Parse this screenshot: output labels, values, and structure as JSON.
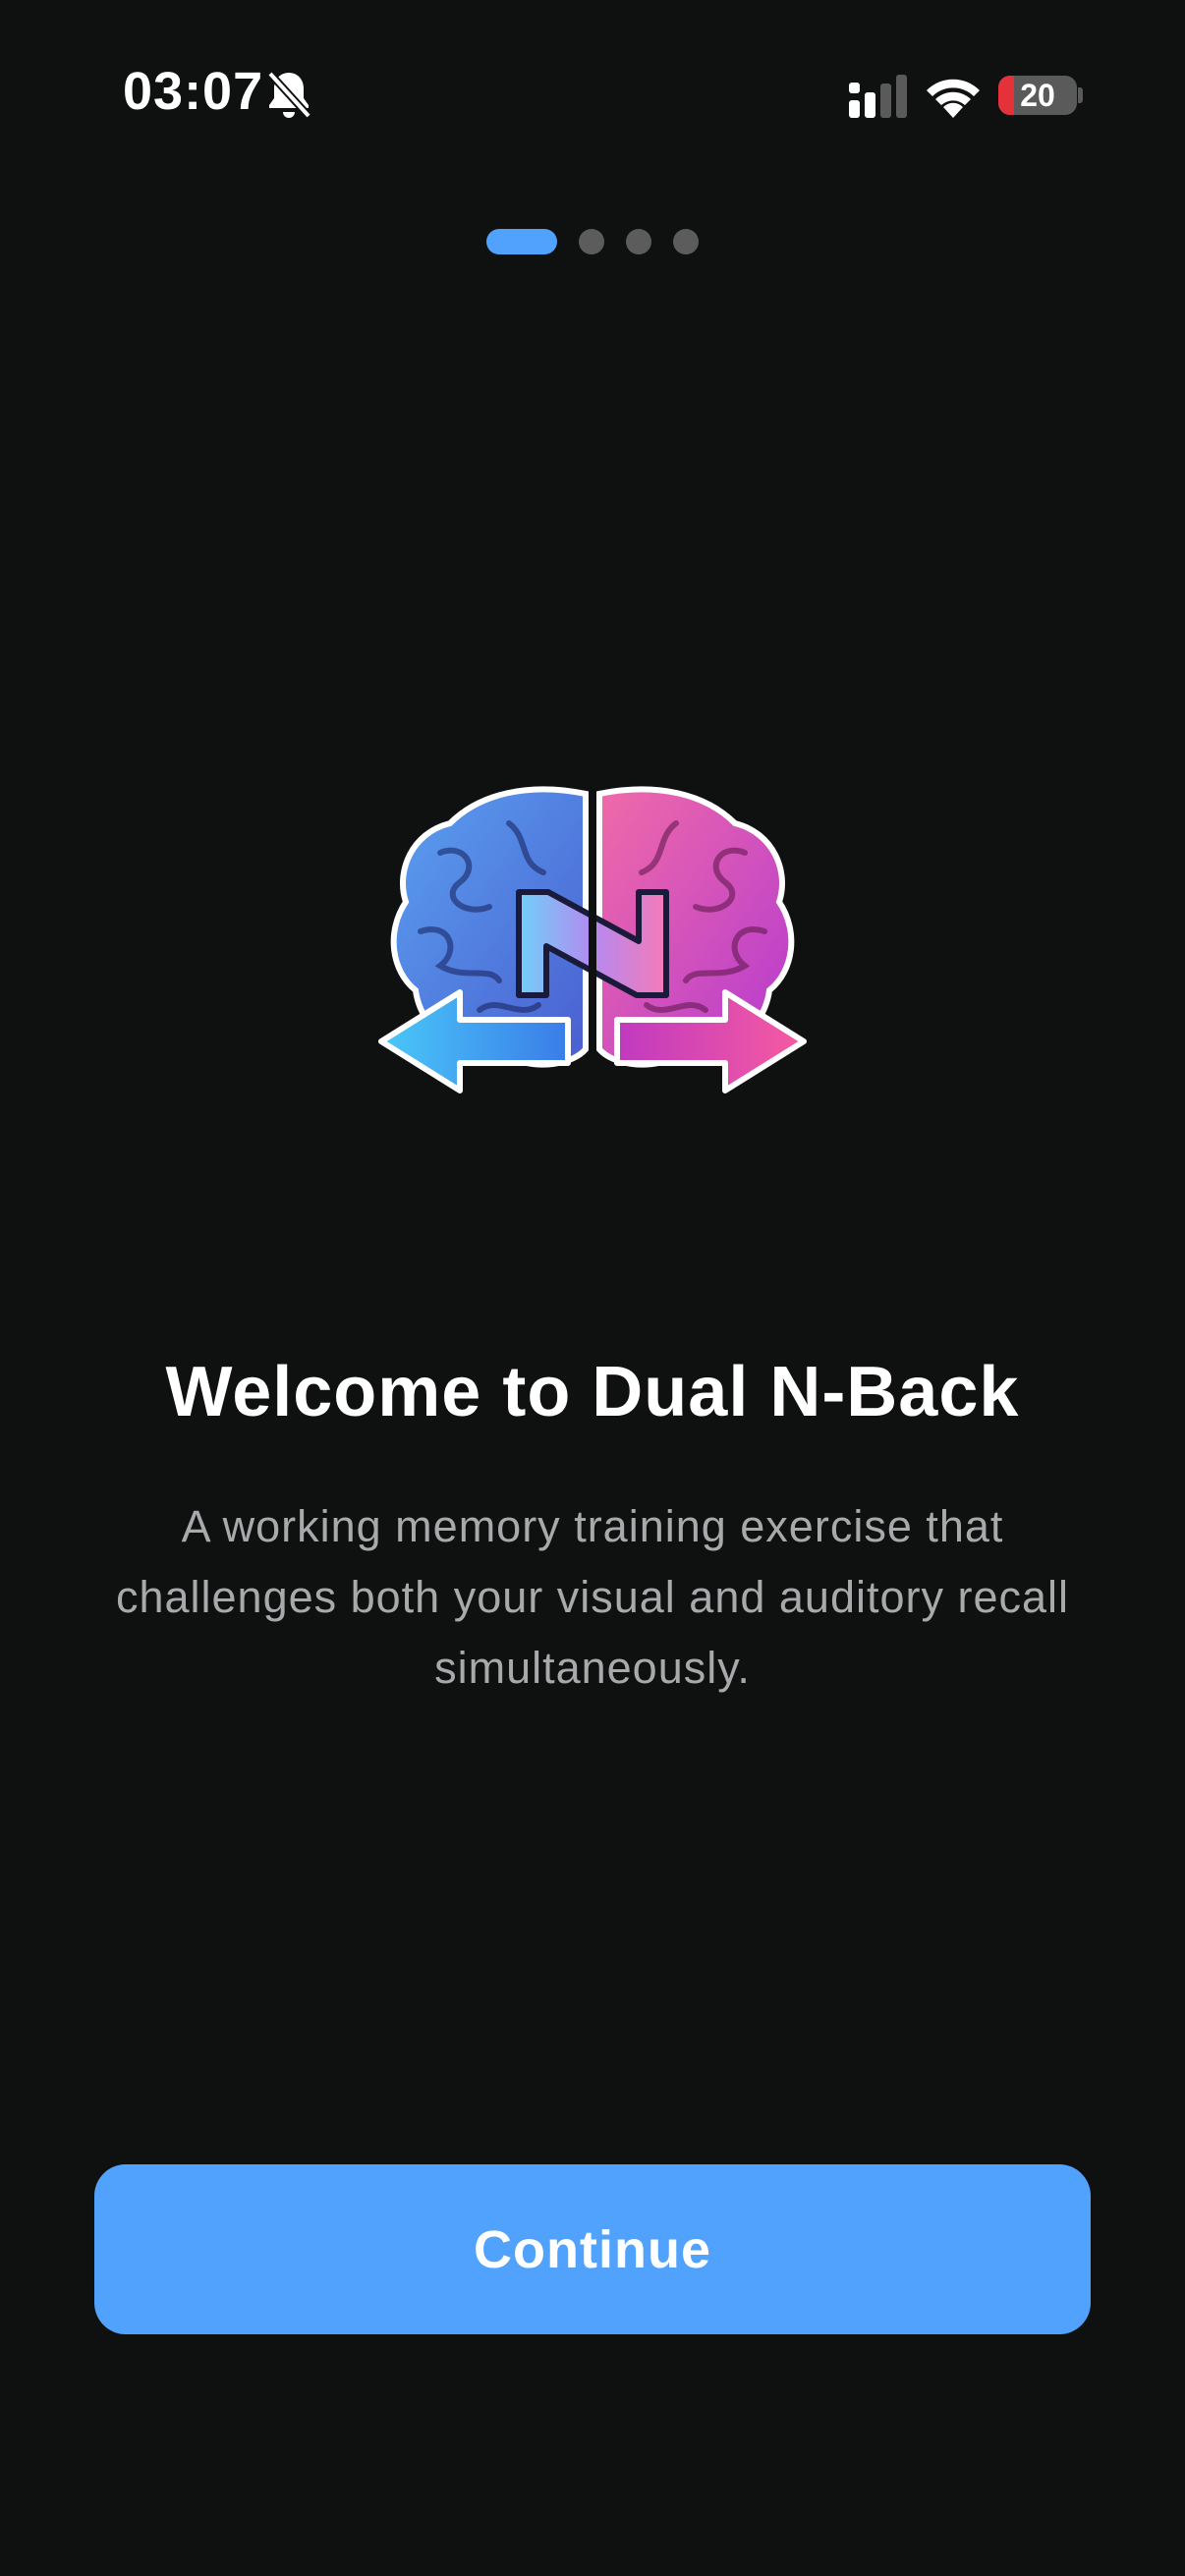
{
  "status_bar": {
    "time": "03:07",
    "battery_level": "20",
    "battery_fraction": 0.2,
    "icons": [
      "bell-slash-icon",
      "cellular-signal-icon",
      "wifi-icon",
      "battery-icon"
    ]
  },
  "onboarding": {
    "page_count": 4,
    "current_page": 1,
    "logo_icon": "brain-n-arrows-icon",
    "title": "Welcome to Dual N-Back",
    "description": "A working memory training exercise that challenges both your visual and auditory recall simultaneously.",
    "continue_label": "Continue"
  },
  "colors": {
    "background": "#0f1010",
    "accent": "#50a2fd",
    "inactive_dot": "#5c5c5c",
    "subtitle_text": "#a9a9ab",
    "battery_low": "#e5313a"
  }
}
